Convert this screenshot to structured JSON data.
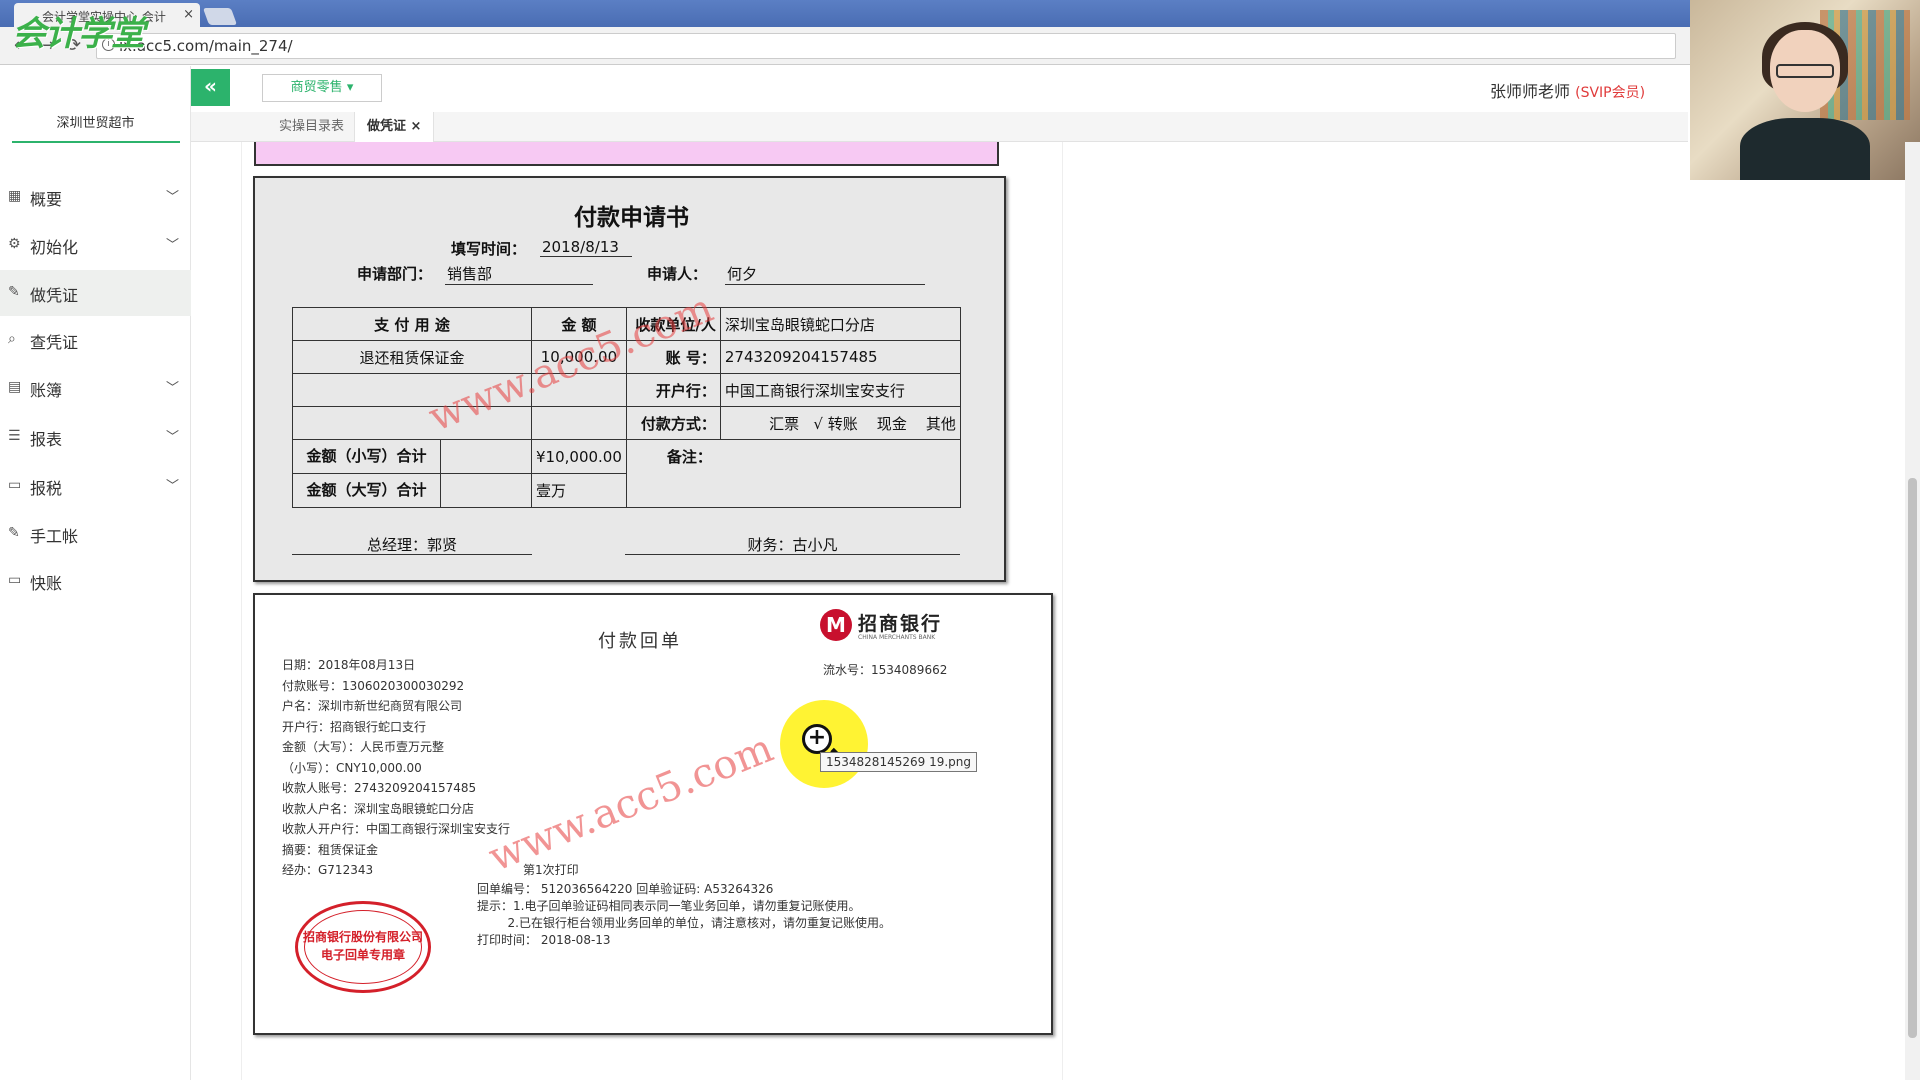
{
  "browser": {
    "tab_title": "会计学堂实操中心 会计",
    "url": "lx.acc5.com/main_274/",
    "logo_text": "会计学堂"
  },
  "header": {
    "company_select": "商贸零售",
    "user": "张师师老师",
    "vip": "(SVIP会员)"
  },
  "sidebar": {
    "company": "深圳世贸超市",
    "items": [
      {
        "label": "概要",
        "icon": "grid-icon",
        "has_arrow": true
      },
      {
        "label": "初始化",
        "icon": "gear-icon",
        "has_arrow": true
      },
      {
        "label": "做凭证",
        "icon": "pen-icon",
        "has_arrow": false
      },
      {
        "label": "查凭证",
        "icon": "search-icon",
        "has_arrow": false
      },
      {
        "label": "账簿",
        "icon": "book-icon",
        "has_arrow": true
      },
      {
        "label": "报表",
        "icon": "report-icon",
        "has_arrow": true
      },
      {
        "label": "报税",
        "icon": "file-icon",
        "has_arrow": true
      },
      {
        "label": "手工帐",
        "icon": "pen-icon",
        "has_arrow": false
      },
      {
        "label": "快账",
        "icon": "file-icon",
        "has_arrow": false
      }
    ]
  },
  "page_tabs": [
    {
      "label": "实操目录表"
    },
    {
      "label": "做凭证"
    }
  ],
  "payment_form": {
    "title": "付款申请书",
    "fill_time_label": "填写时间：",
    "fill_time": "2018/8/13",
    "dept_label": "申请部门：",
    "dept": "销售部",
    "applicant_label": "申请人：",
    "applicant": "何夕",
    "col_purpose": "支 付 用 途",
    "col_amount": "金  额",
    "payee_label": "收款单位/人",
    "payee": "深圳宝岛眼镜蛇口分店",
    "purpose": "退还租赁保证金",
    "amount": "10,000.00",
    "account_label": "账   号：",
    "account": "2743209204157485",
    "bank_label": "开户行：",
    "bank": "中国工商银行深圳宝安支行",
    "method_label": "付款方式：",
    "methods": "汇票   √ 转账    现金    其他",
    "total_small_label": "金额（小写）合计",
    "total_small": "¥10,000.00",
    "total_big_label": "金额（大写）合计",
    "total_big": "壹万",
    "remark_label": "备注：",
    "gm": "总经理：郭贤",
    "finance": "财务：古小凡"
  },
  "receipt": {
    "title": "付款回单",
    "bank_name": "招商银行",
    "bank_en": "CHINA MERCHANTS BANK",
    "serial": "流水号：1534089662",
    "lines": [
      "日期：2018年08月13日",
      "付款账号：1306020300030292",
      "户名：深圳市新世纪商贸有限公司",
      "开户行：招商银行蛇口支行",
      "金额（大写）：人民币壹万元整",
      "（小写）：CNY10,000.00",
      "收款人账号：2743209204157485",
      "收款人户名：深圳宝岛眼镜蛇口分店",
      "收款人开户行：中国工商银行深圳宝安支行",
      "摘要：租赁保证金",
      "经办：G712343"
    ],
    "print_count": "第1次打印",
    "receipt_no": "回单编号： 512036564220 回单验证码: A53264326",
    "tip1": "提示：1.电子回单验证码相同表示同一笔业务回单，请勿重复记账使用。",
    "tip2": "        2.已在银行柜台领用业务回单的单位，请注意核对，请勿重复记账使用。",
    "print_time": "打印时间： 2018-08-13",
    "stamp_line1": "招商银行股份有限公司",
    "stamp_line2": "电子回单专用章"
  },
  "watermark": "www.acc5.com",
  "tooltip": "1534828145269 19.png"
}
